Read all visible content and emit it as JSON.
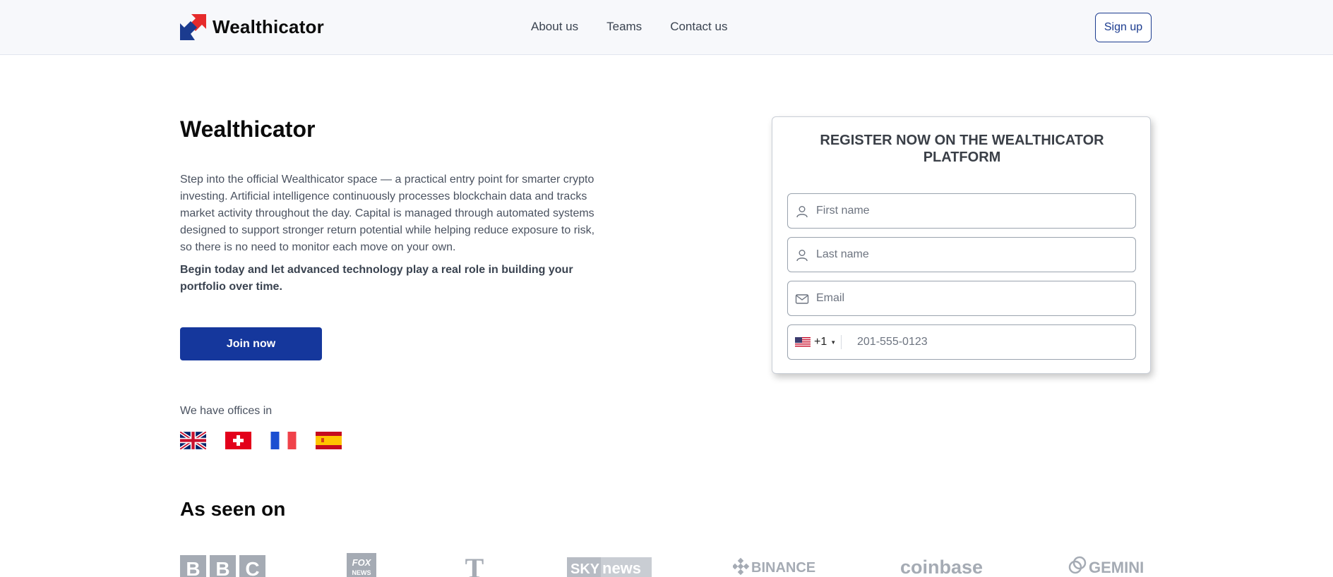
{
  "header": {
    "brand": "Wealthicator",
    "nav": [
      "About us",
      "Teams",
      "Contact us"
    ],
    "signup_label": "Sign up"
  },
  "hero": {
    "title": "Wealthicator",
    "description": "Step into the official Wealthicator space — a practical entry point for smarter crypto investing. Artificial intelligence continuously processes blockchain data and tracks market activity throughout the day. Capital is managed through automated systems designed to support stronger return potential while helping reduce exposure to risk, so there is no need to monitor each move on your own.",
    "bold_text": "Begin today and let advanced technology play a real role in building your portfolio over time.",
    "join_label": "Join now",
    "offices_label": "We have offices in",
    "flags": [
      "uk-flag",
      "switzerland-flag",
      "france-flag",
      "spain-flag"
    ]
  },
  "as_seen_on": {
    "title": "As seen on",
    "logos": [
      "BBC",
      "FOX NEWS",
      "T",
      "SKY news",
      "BINANCE",
      "coinbase",
      "GEMINI"
    ]
  },
  "register": {
    "title": "REGISTER NOW ON THE WEALTHICATOR PLATFORM",
    "first_name_placeholder": "First name",
    "last_name_placeholder": "Last name",
    "email_placeholder": "Email",
    "phone_code": "+1",
    "phone_placeholder": "201-555-0123"
  },
  "colors": {
    "primary": "#15379c",
    "logo_red": "#e62b2b",
    "logo_blue": "#1b3b8f",
    "muted_logo": "#a5abb4"
  }
}
